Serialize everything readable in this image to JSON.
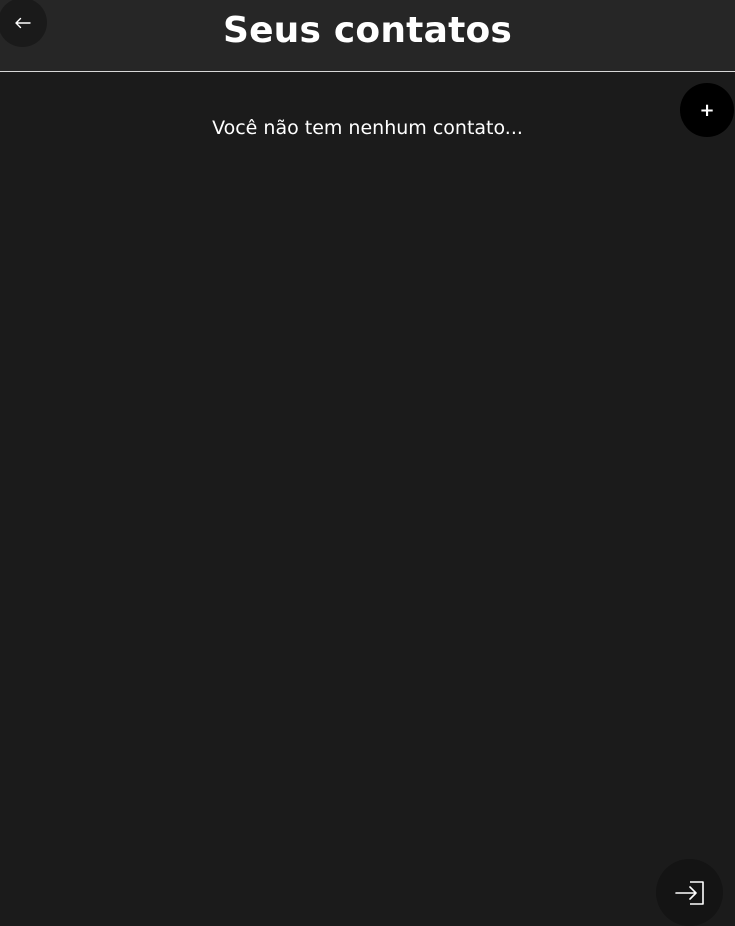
{
  "header": {
    "title": "Seus contatos",
    "back_icon": "arrow-left-icon"
  },
  "actions": {
    "add_label": "+",
    "exit_icon": "sign-in-icon"
  },
  "contacts": {
    "empty_message": "Você não tem nenhum contato..."
  },
  "colors": {
    "background": "#1b1b1b",
    "header_background": "#262626",
    "text": "#ffffff",
    "button_dark": "#000000"
  }
}
